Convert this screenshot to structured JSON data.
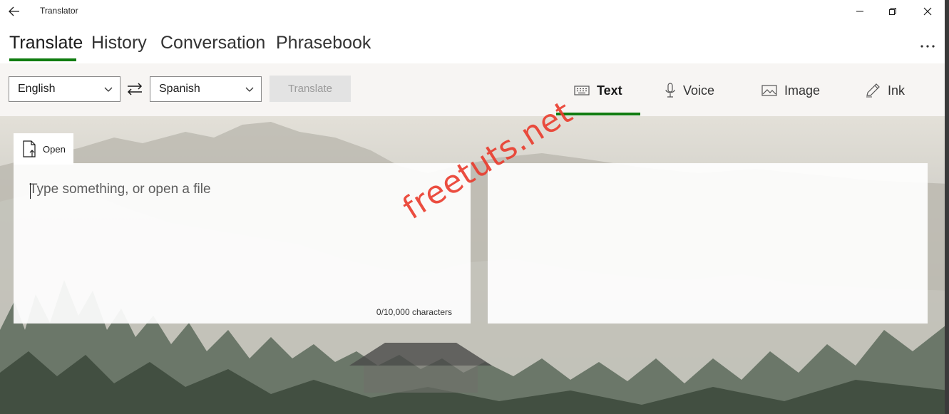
{
  "window": {
    "title": "Translator"
  },
  "tabs": [
    {
      "label": "Translate",
      "active": true
    },
    {
      "label": "History",
      "active": false
    },
    {
      "label": "Conversation",
      "active": false
    },
    {
      "label": "Phrasebook",
      "active": false
    }
  ],
  "toolbar": {
    "from_language": "English",
    "to_language": "Spanish",
    "translate_label": "Translate",
    "modes": [
      {
        "label": "Text",
        "icon": "keyboard-icon",
        "active": true
      },
      {
        "label": "Voice",
        "icon": "microphone-icon",
        "active": false
      },
      {
        "label": "Image",
        "icon": "image-icon",
        "active": false
      },
      {
        "label": "Ink",
        "icon": "pen-icon",
        "active": false
      }
    ]
  },
  "input": {
    "open_label": "Open",
    "placeholder": "Type something, or open a file",
    "value": "",
    "char_count": "0/10,000 characters"
  },
  "output": {
    "value": ""
  },
  "watermark": "freetuts.net",
  "colors": {
    "accent": "#107c10",
    "watermark": "#ea3b2c",
    "translate_button_bg": "#e3e3e3"
  }
}
